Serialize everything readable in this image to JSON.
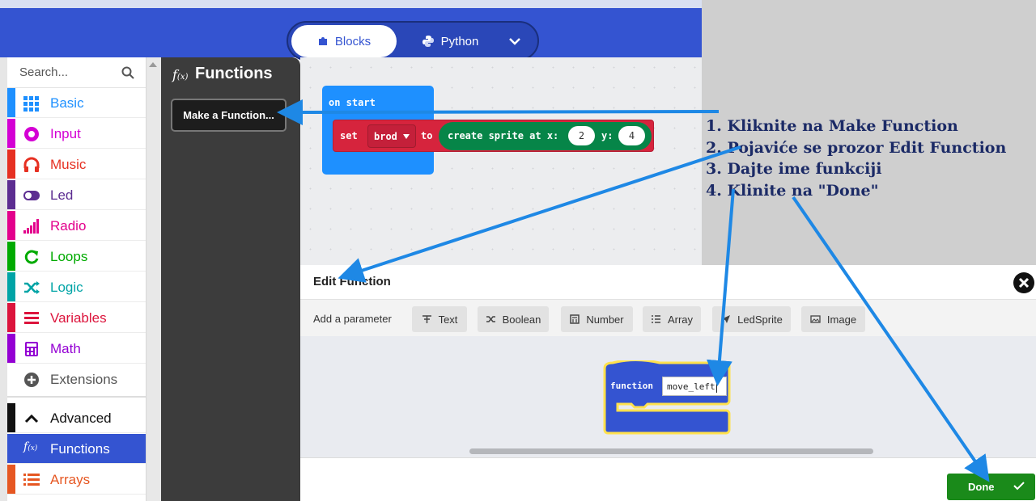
{
  "header": {
    "blocks_label": "Blocks",
    "python_label": "Python"
  },
  "toolbox": {
    "search_placeholder": "Search...",
    "categories": [
      {
        "label": "Basic",
        "color": "#1e90ff"
      },
      {
        "label": "Input",
        "color": "#d400d4"
      },
      {
        "label": "Music",
        "color": "#e63022"
      },
      {
        "label": "Led",
        "color": "#5c2d91"
      },
      {
        "label": "Radio",
        "color": "#e3008c"
      },
      {
        "label": "Loops",
        "color": "#00aa00"
      },
      {
        "label": "Logic",
        "color": "#00a4a6"
      },
      {
        "label": "Variables",
        "color": "#dc143c"
      },
      {
        "label": "Math",
        "color": "#9400d3"
      },
      {
        "label": "Extensions",
        "color": "#555555"
      },
      {
        "label": "Advanced",
        "color": "#000000"
      },
      {
        "label": "Functions",
        "color": "#3454d1"
      },
      {
        "label": "Arrays",
        "color": "#e65722"
      }
    ]
  },
  "flyout": {
    "title": "Functions",
    "icon": "f(x)",
    "make_function": "Make a Function..."
  },
  "workspace": {
    "on_start": "on start",
    "set": "set",
    "variable": "brod",
    "to": "to",
    "create_sprite": "create sprite at x:",
    "x_value": "2",
    "y_label": "y:",
    "y_value": "4"
  },
  "instructions": [
    "1. Kliknite na Make Function",
    "2. Pojaviće se prozor Edit Function",
    "3. Dajte ime funkciji",
    "4. Klinite na \"Done\""
  ],
  "dialog": {
    "title": "Edit Function",
    "add_parameter": "Add a parameter",
    "param_buttons": [
      "Text",
      "Boolean",
      "Number",
      "Array",
      "LedSprite",
      "Image"
    ],
    "function_keyword": "function",
    "function_name": "move_left",
    "done": "Done"
  },
  "colors": {
    "header": "#3454d1",
    "flyout": "#3c3c3c",
    "annotation_arrow": "#1e88e5",
    "done": "#1a8a1a",
    "instruction_text": "#1b2a66"
  }
}
